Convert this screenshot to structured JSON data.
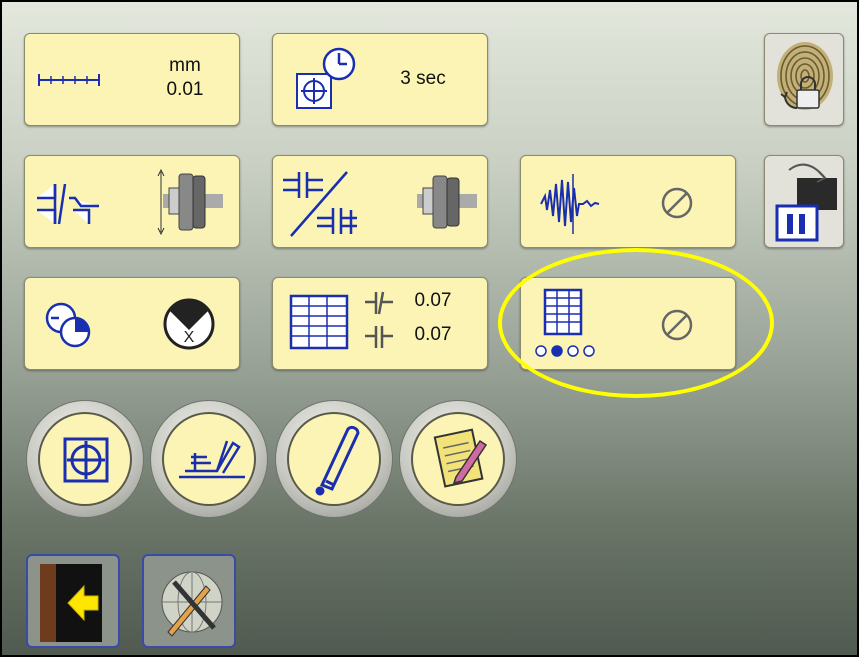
{
  "units_button": {
    "unit": "mm",
    "resolution": "0.01",
    "icon": "ruler-icon"
  },
  "timer_button": {
    "label": "3 sec",
    "icon": "target-clock-icon"
  },
  "fingerprint_button": {
    "icon": "fingerprint-lock-icon"
  },
  "coupling_type_button": {
    "icon": "coupling-icon",
    "icon2": "shaft-coupling-icon"
  },
  "coupling_mode_button": {
    "icon": "coupling-spacer-icon",
    "icon2": "shaft-coupling-icon"
  },
  "vibration_button": {
    "icon": "vibration-icon",
    "state_icon": "disabled-icon"
  },
  "file_button": {
    "icon": "folder-pause-icon"
  },
  "sensor_button": {
    "icon": "sensor-icon",
    "icon2": "target-x-icon"
  },
  "tolerance_button": {
    "icon": "table-icon",
    "value1": "0.07",
    "value2": "0.07"
  },
  "table_mode_button": {
    "icon": "table-icon",
    "state_icon": "disabled-icon",
    "page_dots": [
      false,
      true,
      false,
      false
    ]
  },
  "round_buttons": [
    {
      "icon": "target-icon"
    },
    {
      "icon": "machine-icon"
    },
    {
      "icon": "pen-icon"
    },
    {
      "icon": "notepad-icon"
    }
  ],
  "bottom_buttons": [
    {
      "icon": "exit-door-icon"
    },
    {
      "icon": "globe-tools-icon"
    }
  ],
  "highlight_color": "#ffff00",
  "button_color": "#fbf4b4"
}
